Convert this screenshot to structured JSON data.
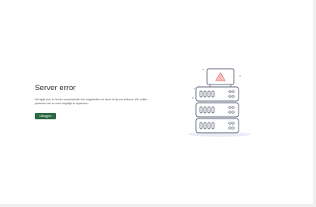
{
  "error": {
    "title": "Server error",
    "message": "Het spijt ons, er is een onverwachte fout opgetreden en deze is bij ons bekend. We zullen proberen het zo snel mogelijk te repareren.",
    "button_label": "Uitloggen"
  },
  "illustration": {
    "icon": "server-stack-warning-icon",
    "warning_glyph": "!"
  },
  "colors": {
    "button_bg": "#2f6b46",
    "warning": "#e25c5c",
    "outline": "#5b6275"
  }
}
